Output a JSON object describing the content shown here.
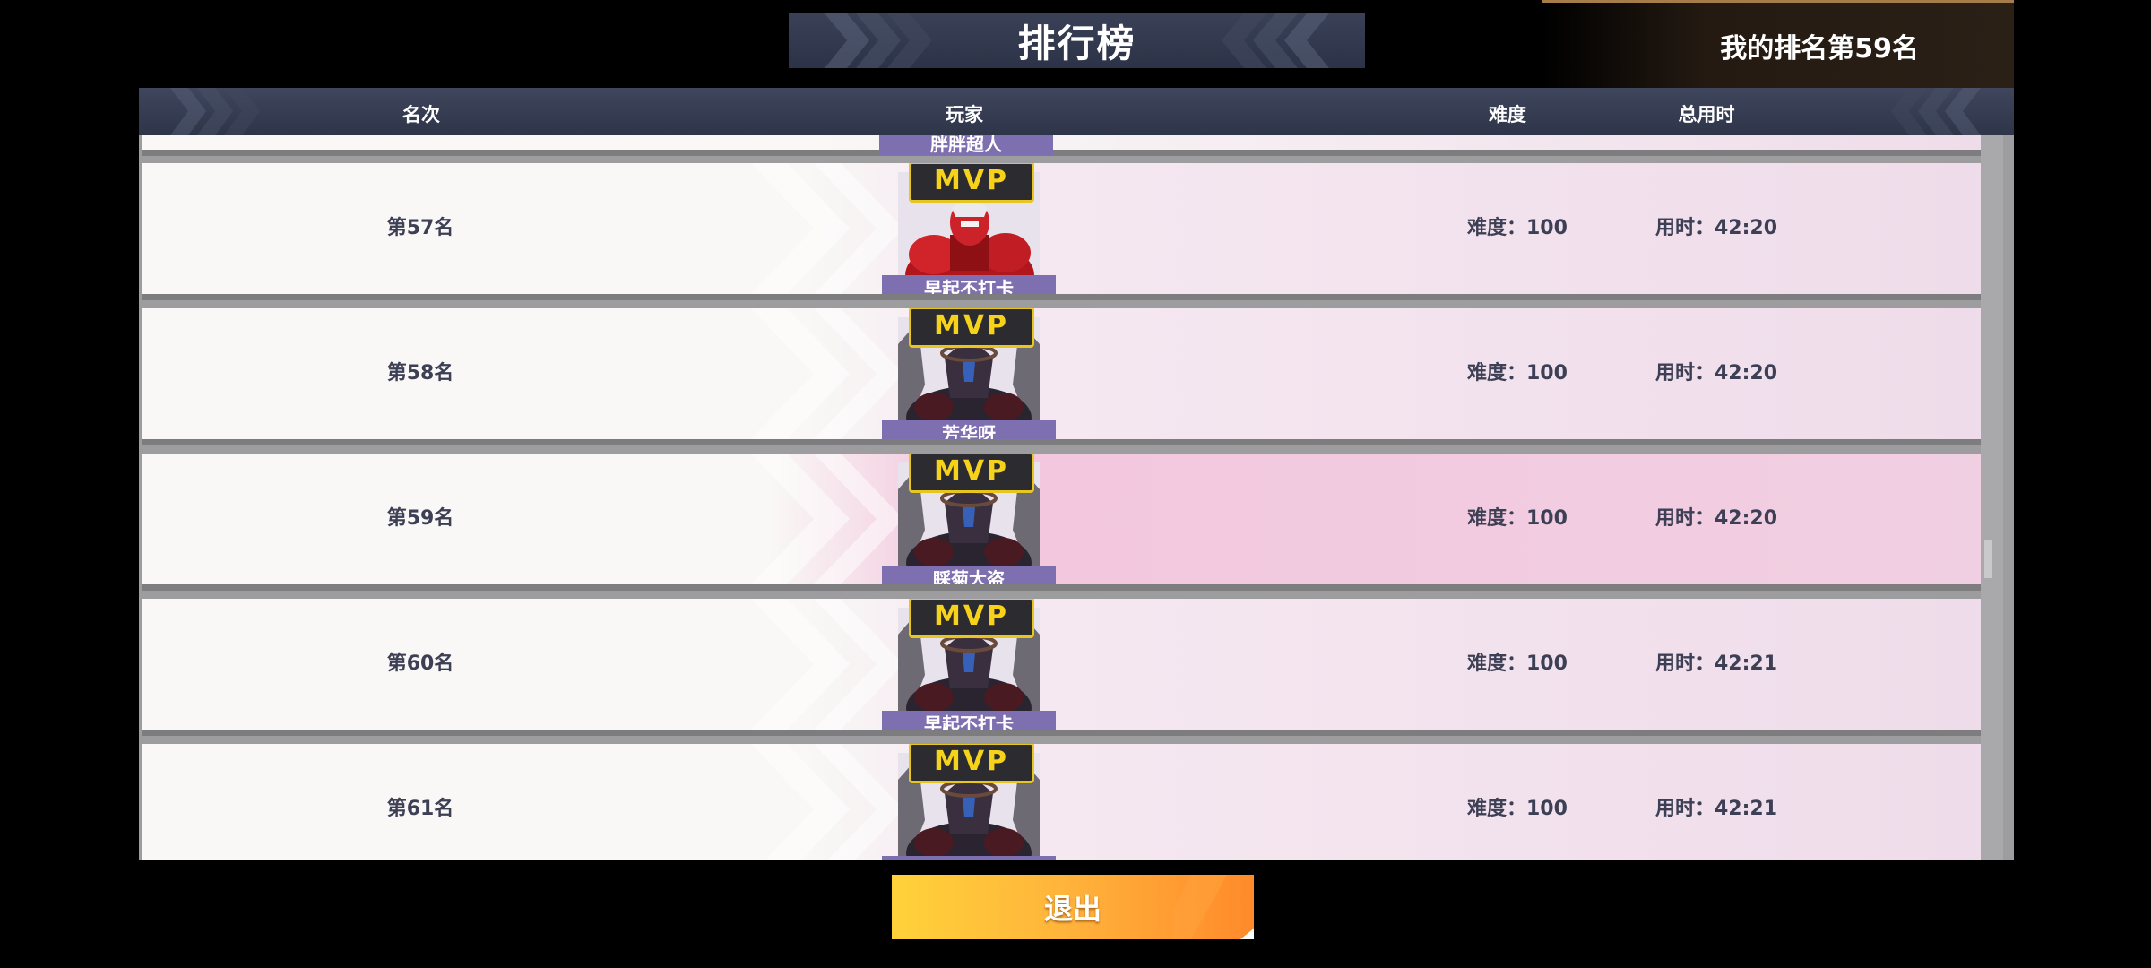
{
  "header": {
    "title": "排行榜",
    "my_rank": "我的排名第59名"
  },
  "table": {
    "columns": {
      "rank": "名次",
      "player": "玩家",
      "difficulty": "难度",
      "total_time": "总用时"
    },
    "partial_top_row": {
      "player_name": "胖胖超人"
    },
    "rows": [
      {
        "rank": "第57名",
        "player_name": "早起不打卡",
        "badge": "MVP",
        "avatar": "red-robot-avatar",
        "difficulty": "难度：100",
        "time": "用时：42:20",
        "highlighted": false
      },
      {
        "rank": "第58名",
        "player_name": "芳华呀",
        "badge": "MVP",
        "avatar": "dark-mech-avatar",
        "difficulty": "难度：100",
        "time": "用时：42:20",
        "highlighted": false
      },
      {
        "rank": "第59名",
        "player_name": "睬菊大盗",
        "badge": "MVP",
        "avatar": "dark-mech-avatar",
        "difficulty": "难度：100",
        "time": "用时：42:20",
        "highlighted": true
      },
      {
        "rank": "第60名",
        "player_name": "早起不打卡",
        "badge": "MVP",
        "avatar": "dark-mech-avatar",
        "difficulty": "难度：100",
        "time": "用时：42:21",
        "highlighted": false
      },
      {
        "rank": "第61名",
        "player_name": "",
        "badge": "MVP",
        "avatar": "dark-mech-avatar",
        "difficulty": "难度：100",
        "time": "用时：42:21",
        "highlighted": false
      }
    ]
  },
  "footer": {
    "exit_label": "退出"
  },
  "colors": {
    "banner": "#333a4f",
    "row_text": "#3d3f55",
    "name_bar": "#7e6fb0",
    "mvp_gold": "#f6d21a",
    "exit_orange": "#ff8a2a"
  }
}
